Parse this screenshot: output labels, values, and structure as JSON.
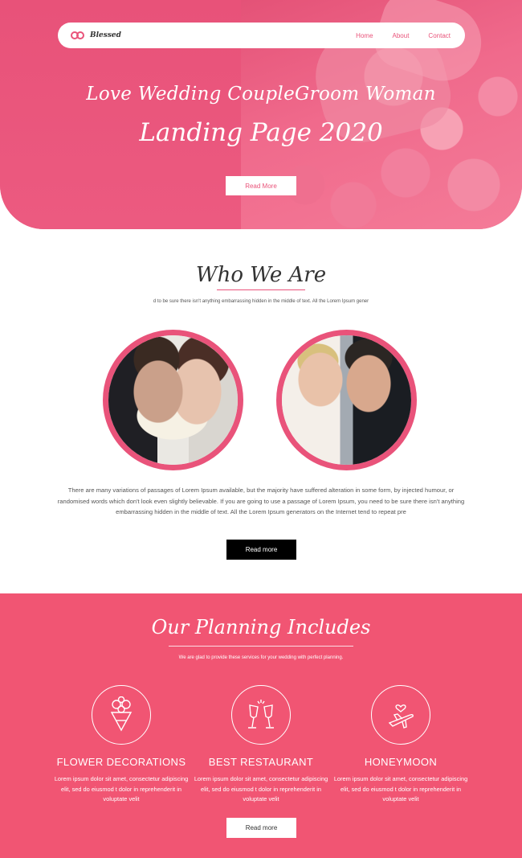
{
  "nav": {
    "logo_text": "Blessed",
    "links": [
      "Home",
      "About",
      "Contact"
    ]
  },
  "hero": {
    "title": "Love Wedding CoupleGroom Woman",
    "subtitle": "Landing Page 2020",
    "button": "Read More"
  },
  "who": {
    "title": "Who We Are",
    "subtitle": "d to be sure there isn't anything embarrassing hidden in the middle of text. All the Lorem Ipsum gener",
    "paragraph": "There are many variations of passages of Lorem Ipsum available, but the majority have suffered alteration in some form, by injected humour, or randomised words which don't look even slightly believable. If you are going to use a passage of Lorem Ipsum, you need to be sure there isn't anything embarrassing hidden in the middle of text. All the Lorem Ipsum generators on the Internet tend to repeat pre",
    "button": "Read more"
  },
  "planning": {
    "title": "Our Planning Includes",
    "subtitle": "We are glad to provide these services for your wedding with perfect planning.",
    "services": [
      {
        "title": "FLOWER DECORATIONS",
        "text": "Lorem ipsum dolor sit amet, consectetur adipiscing elit, sed do eiusmod t dolor in reprehenderit in voluptate velit",
        "icon": "flower-bouquet-icon"
      },
      {
        "title": "BEST RESTAURANT",
        "text": "Lorem ipsum dolor sit amet, consectetur adipiscing elit, sed do eiusmod t dolor in reprehenderit in voluptate velit",
        "icon": "champagne-glasses-icon"
      },
      {
        "title": "HONEYMOON",
        "text": "Lorem ipsum dolor sit amet, consectetur adipiscing elit, sed do eiusmod t dolor in reprehenderit in voluptate velit",
        "icon": "airplane-heart-icon"
      }
    ],
    "button": "Read more"
  },
  "colors": {
    "accent": "#e9537a",
    "planning_bg": "#f15573"
  }
}
